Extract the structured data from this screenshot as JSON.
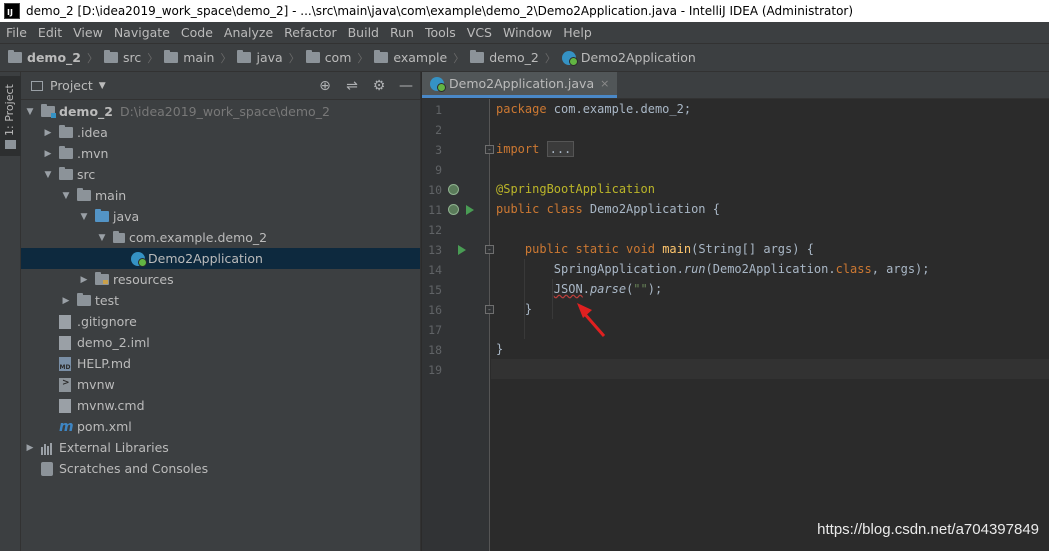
{
  "window": {
    "title": "demo_2 [D:\\idea2019_work_space\\demo_2] - ...\\src\\main\\java\\com\\example\\demo_2\\Demo2Application.java - IntelliJ IDEA (Administrator)",
    "app_icon": "IJ"
  },
  "menu": [
    "File",
    "Edit",
    "View",
    "Navigate",
    "Code",
    "Analyze",
    "Refactor",
    "Build",
    "Run",
    "Tools",
    "VCS",
    "Window",
    "Help"
  ],
  "breadcrumb": [
    "demo_2",
    "src",
    "main",
    "java",
    "com",
    "example",
    "demo_2",
    "Demo2Application"
  ],
  "toolstrip": {
    "project_tab": "1: Project"
  },
  "project_panel": {
    "title": "Project",
    "dropdown_glyph": "▼",
    "tools": [
      "target-icon",
      "collapse-icon",
      "gear-icon",
      "minimize-icon"
    ],
    "tree": [
      {
        "label": "demo_2",
        "hint": "D:\\idea2019_work_space\\demo_2",
        "depth": 0,
        "arrow": "▼",
        "icon": "module-folder",
        "bold": true
      },
      {
        "label": ".idea",
        "depth": 1,
        "arrow": "▶",
        "icon": "folder"
      },
      {
        "label": ".mvn",
        "depth": 1,
        "arrow": "▶",
        "icon": "folder"
      },
      {
        "label": "src",
        "depth": 1,
        "arrow": "▼",
        "icon": "folder"
      },
      {
        "label": "main",
        "depth": 2,
        "arrow": "▼",
        "icon": "folder"
      },
      {
        "label": "java",
        "depth": 3,
        "arrow": "▼",
        "icon": "source-folder"
      },
      {
        "label": "com.example.demo_2",
        "depth": 4,
        "arrow": "▼",
        "icon": "package"
      },
      {
        "label": "Demo2Application",
        "depth": 5,
        "arrow": "",
        "icon": "spring-class",
        "selected": true
      },
      {
        "label": "resources",
        "depth": 3,
        "arrow": "▶",
        "icon": "resources-folder"
      },
      {
        "label": "test",
        "depth": 2,
        "arrow": "▶",
        "icon": "folder"
      },
      {
        "label": ".gitignore",
        "depth": 1,
        "arrow": "",
        "icon": "text-file"
      },
      {
        "label": "demo_2.iml",
        "depth": 1,
        "arrow": "",
        "icon": "iml-file"
      },
      {
        "label": "HELP.md",
        "depth": 1,
        "arrow": "",
        "icon": "md-file"
      },
      {
        "label": "mvnw",
        "depth": 1,
        "arrow": "",
        "icon": "terminal-file"
      },
      {
        "label": "mvnw.cmd",
        "depth": 1,
        "arrow": "",
        "icon": "text-file"
      },
      {
        "label": "pom.xml",
        "depth": 1,
        "arrow": "",
        "icon": "maven-file"
      },
      {
        "label": "External Libraries",
        "depth": 0,
        "arrow": "▶",
        "icon": "libraries"
      },
      {
        "label": "Scratches and Consoles",
        "depth": 0,
        "arrow": "",
        "icon": "scratches"
      }
    ]
  },
  "editor": {
    "tab": {
      "label": "Demo2Application.java",
      "close": "×"
    },
    "line_numbers": [
      "1",
      "2",
      "3",
      "9",
      "10",
      "11",
      "12",
      "13",
      "14",
      "15",
      "16",
      "17",
      "18",
      "19"
    ],
    "lines": {
      "l1_kw": "package",
      "l1_rest": " com.example.demo_2;",
      "l3_kw": "import",
      "l3_fold": "...",
      "l10_ann": "@SpringBootApplication",
      "l11_kw": "public class",
      "l11_rest": " Demo2Application {",
      "l13_kw": "public static void",
      "l13_fn": "main",
      "l13_rest": "(String[] args) {",
      "l14_a": "SpringApplication.",
      "l14_run": "run",
      "l14_b": "(Demo2Application.",
      "l14_kw": "class",
      "l14_c": ", args);",
      "l15_json": "JSON",
      "l15_dot": ".",
      "l15_parse": "parse",
      "l15_open": "(",
      "l15_str": "\"\"",
      "l15_close": ");",
      "l16": "}",
      "l18": "}"
    }
  },
  "colors": {
    "annotation_arrow": "#e02020",
    "selection": "#0d293e",
    "tab_underline": "#4a88c7"
  },
  "watermark": "https://blog.csdn.net/a704397849"
}
